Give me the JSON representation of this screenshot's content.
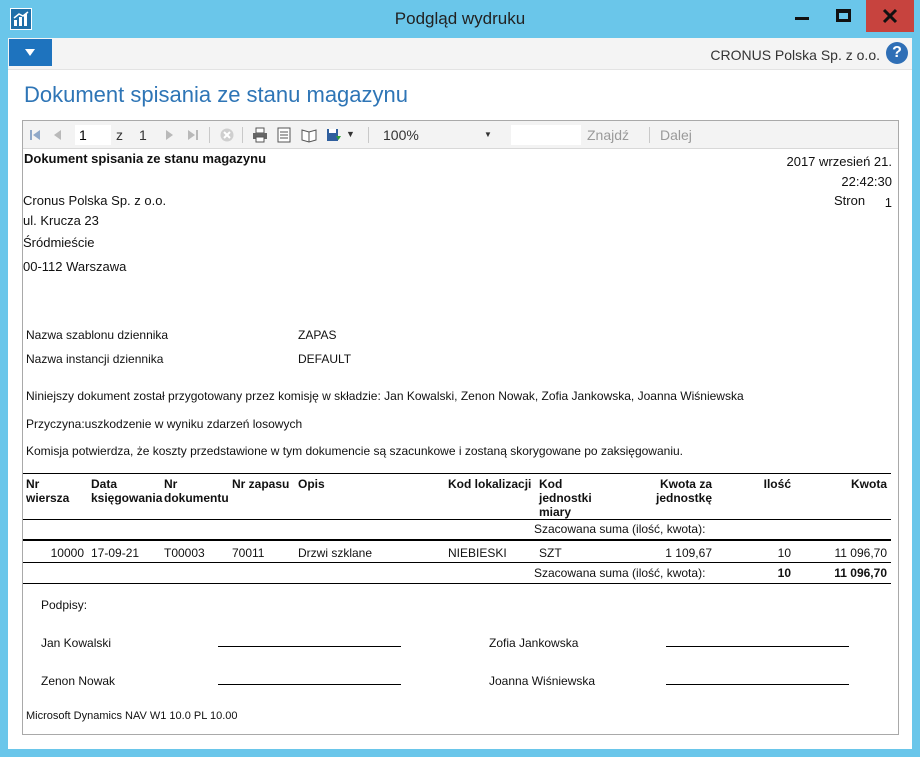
{
  "window": {
    "title": "Podgląd wydruku"
  },
  "ribbon": {
    "company": "CRONUS Polska Sp. z o.o.",
    "help": "?"
  },
  "page_title": "Dokument spisania ze stanu magazynu",
  "toolbar": {
    "page_current": "1",
    "page_of_label": "z",
    "page_total": "1",
    "zoom": "100%",
    "find_label": "Znajdź",
    "next_label": "Dalej"
  },
  "report": {
    "title": "Dokument spisania ze stanu magazynu",
    "date": "2017 wrzesień 21.",
    "time": "22:42:30",
    "pages_label": "Stron",
    "pages_value": "1",
    "address": {
      "line1": "Cronus Polska Sp. z o.o.",
      "line2": "ul. Krucza 23",
      "line3": "Śródmieście",
      "line4": "00-112 Warszawa"
    },
    "journal": {
      "template_label": "Nazwa szablonu dziennika",
      "template_value": "ZAPAS",
      "batch_label": "Nazwa instancji dziennika",
      "batch_value": "DEFAULT"
    },
    "paragraphs": {
      "committee": "Niniejszy dokument został przygotowany przez komisję w składzie: Jan Kowalski, Zenon Nowak, Zofia Jankowska, Joanna Wiśniewska",
      "reason": "Przyczyna:uszkodzenie w wyniku zdarzeń losowych",
      "confirm": "Komisja potwierdza, że koszty przedstawione w tym dokumencie są szacunkowe i zostaną skorygowane po zaksięgowaniu."
    },
    "columns": {
      "line_no": "Nr wiersza",
      "posting_date": "Data księgowania",
      "doc_no": "Nr dokumentu",
      "item_no": "Nr zapasu",
      "description": "Opis",
      "location": "Kod lokalizacji",
      "uom": "Kod jednostki miary",
      "unit_amount": "Kwota za jednostkę",
      "quantity": "Ilość",
      "amount": "Kwota"
    },
    "estimated_sum_label": "Szacowana suma (ilość, kwota):",
    "rows": [
      {
        "line_no": "10000",
        "posting_date": "17-09-21",
        "doc_no": "T00003",
        "item_no": "70011",
        "description": "Drzwi szklane",
        "location": "NIEBIESKI",
        "uom": "SZT",
        "unit_amount": "1 109,67",
        "quantity": "10",
        "amount": "11 096,70"
      }
    ],
    "total": {
      "label": "Szacowana suma (ilość, kwota):",
      "quantity": "10",
      "amount": "11 096,70"
    },
    "signatures": {
      "label": "Podpisy:",
      "names": [
        "Jan Kowalski",
        "Zofia Jankowska",
        "Zenon Nowak",
        "Joanna Wiśniewska"
      ]
    },
    "footer": "Microsoft Dynamics NAV W1 10.0  PL 10.00"
  }
}
